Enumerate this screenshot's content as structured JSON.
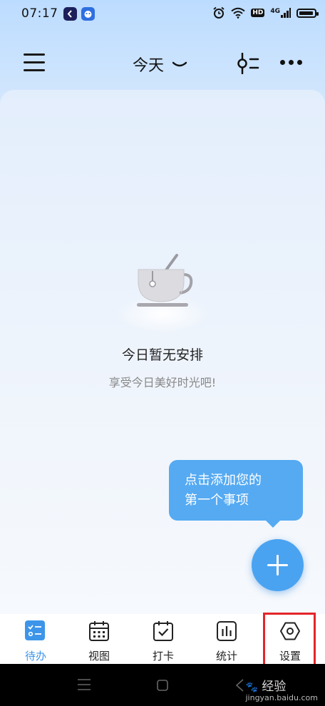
{
  "status_bar": {
    "time": "07:17",
    "hd": "HD",
    "network": "4G",
    "battery_level": 0.95
  },
  "header": {
    "title": "今天",
    "icons": [
      "menu-icon",
      "chevron-down-icon",
      "filter-icon",
      "more-icon"
    ]
  },
  "empty_state": {
    "title": "今日暂无安排",
    "subtitle": "享受今日美好时光吧!"
  },
  "tooltip": {
    "line1": "点击添加您的",
    "line2": "第一个事项"
  },
  "tabs": [
    {
      "label": "待办",
      "icon": "todo-icon",
      "active": true
    },
    {
      "label": "视图",
      "icon": "calendar-icon",
      "active": false
    },
    {
      "label": "打卡",
      "icon": "checkin-icon",
      "active": false
    },
    {
      "label": "统计",
      "icon": "stats-icon",
      "active": false
    },
    {
      "label": "设置",
      "icon": "settings-icon",
      "active": false
    }
  ],
  "watermark": {
    "brand": "经验",
    "url": "jingyan.baidu.com"
  },
  "colors": {
    "accent": "#4aa3f1",
    "highlight": "#e3252a"
  }
}
